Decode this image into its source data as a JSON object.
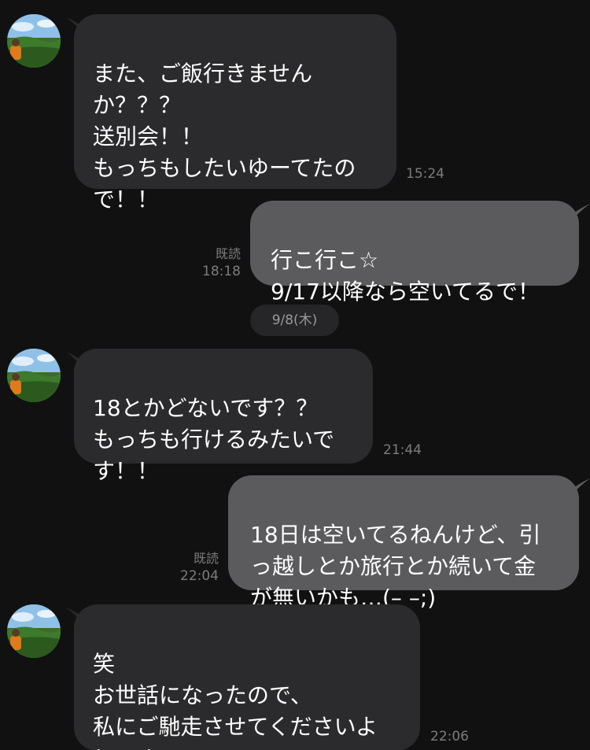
{
  "chat": {
    "date_separator": "9/8(木)",
    "messages": [
      {
        "direction": "incoming",
        "text": "また、ご飯行きません\nか？？？\n送別会！！\nもっちもしたいゆーてたの\nで！！",
        "time": "15:24"
      },
      {
        "direction": "outgoing",
        "text": "行こ行こ☆\n9/17以降なら空いてるで！",
        "read_label": "既読",
        "time": "18:18"
      },
      {
        "direction": "incoming",
        "text": "18とかどないです？？\nもっちも行けるみたいで\nす！！",
        "time": "21:44"
      },
      {
        "direction": "outgoing",
        "text": "18日は空いてるねんけど、引\nっ越しとか旅行とか続いて金\nが無いかも…(– –;)",
        "read_label": "既読",
        "time": "22:04"
      },
      {
        "direction": "incoming",
        "text": "笑\nお世話になったので、\n私にご馳走させてくださいよ\n(^-^)",
        "time": "22:06"
      }
    ]
  },
  "colors": {
    "background": "#111111",
    "incoming_bubble": "#2b2b2d",
    "outgoing_bubble": "#5b5b5d",
    "meta_text": "#7c7c7e"
  },
  "icons": {
    "avatar": "landscape-photo-avatar"
  }
}
